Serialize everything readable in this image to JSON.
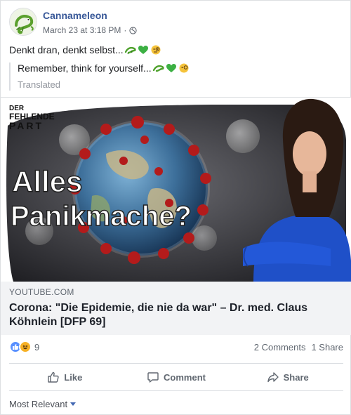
{
  "post": {
    "author": "Cannameleon",
    "timestamp": "March 23 at 3:18 PM",
    "privacy_icon": "globe-icon",
    "text": "Denkt dran, denkt selbst...",
    "translation": {
      "text": "Remember, think for yourself...",
      "label": "Translated"
    },
    "emojis": [
      "lizard-emoji",
      "green-heart-emoji",
      "face-with-monocle-emoji"
    ]
  },
  "link_preview": {
    "thumbnail_text": {
      "brand_line1": "DER",
      "brand_line2": "FEHLENDE",
      "brand_line3": "PART",
      "headline_line1": "Alles",
      "headline_line2": "Panikmache?"
    },
    "domain": "YOUTUBE.COM",
    "title": "Corona: \"Die Epidemie, die nie da war\" – Dr. med. Claus Köhnlein [DFP 69]"
  },
  "engagement": {
    "reaction_icons": [
      "like-reaction-icon",
      "haha-reaction-icon"
    ],
    "reaction_count": "9",
    "comments": "2 Comments",
    "shares": "1 Share"
  },
  "actions": {
    "like": "Like",
    "comment": "Comment",
    "share": "Share"
  },
  "comments_sort": {
    "selected": "Most Relevant"
  },
  "colors": {
    "link_blue": "#385898",
    "muted": "#606770",
    "like_blue": "#5890ff",
    "haha_yellow": "#f7b125",
    "preview_bg": "#f2f3f5",
    "dress_blue": "#1f50c8"
  }
}
